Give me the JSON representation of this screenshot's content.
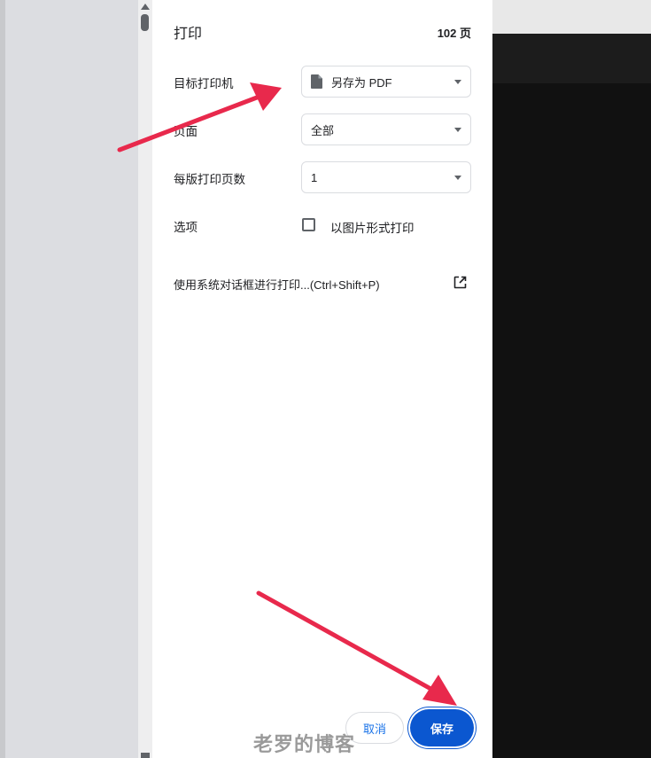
{
  "header": {
    "title": "打印",
    "page_count": "102 页"
  },
  "destination": {
    "label": "目标打印机",
    "value": "另存为 PDF",
    "icon": "document-icon"
  },
  "pages": {
    "label": "页面",
    "value": "全部"
  },
  "pages_per_sheet": {
    "label": "每版打印页数",
    "value": "1"
  },
  "options": {
    "label": "选项",
    "checkbox_label": "以图片形式打印",
    "checked": false
  },
  "system_dialog": {
    "label": "使用系统对话框进行打印...(Ctrl+Shift+P)",
    "icon": "open-external-icon"
  },
  "footer": {
    "cancel_label": "取消",
    "save_label": "保存"
  },
  "watermark": "老罗的博客",
  "colors": {
    "accent": "#0b57d0",
    "annotation_arrow": "#e8294c"
  }
}
